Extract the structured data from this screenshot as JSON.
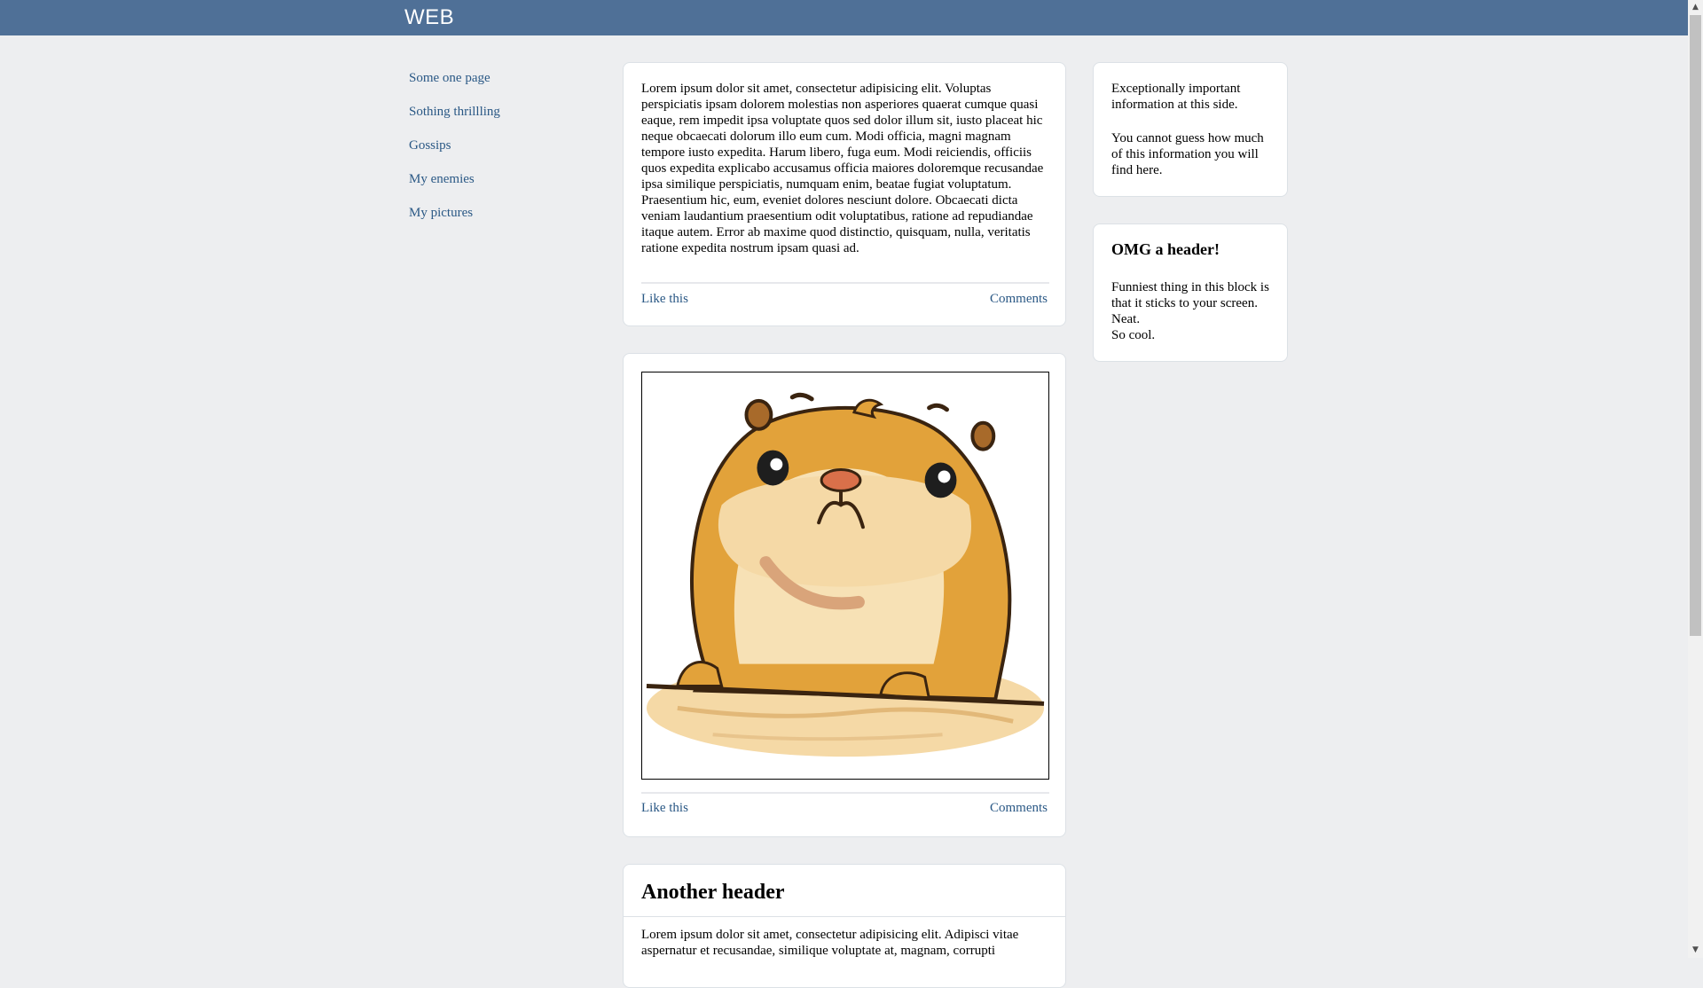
{
  "app": {
    "logo": "WEB"
  },
  "sidebar": {
    "items": [
      {
        "label": "Some one page"
      },
      {
        "label": "Sothing thrillling"
      },
      {
        "label": "Gossips"
      },
      {
        "label": "My enemies"
      },
      {
        "label": "My pictures"
      }
    ]
  },
  "feed": {
    "post1": {
      "text": "Lorem ipsum dolor sit amet, consectetur adipisicing elit. Voluptas perspiciatis ipsam dolorem molestias non asperiores quaerat cumque quasi eaque, rem impedit ipsa voluptate quos sed dolor illum sit, iusto placeat hic neque obcaecati dolorum illo eum cum. Modi officia, magni magnam tempore iusto expedita. Harum libero, fuga eum. Modi reiciendis, officiis quos expedita explicabo accusamus officia maiores doloremque recusandae ipsa similique perspiciatis, numquam enim, beatae fugiat voluptatum. Praesentium hic, eum, eveniet dolores nesciunt dolore. Obcaecati dicta veniam laudantium praesentium odit voluptatibus, ratione ad repudiandae itaque autem. Error ab maxime quod distinctio, quisquam, nulla, veritatis ratione expedita nostrum ipsam quasi ad.",
      "like_label": "Like this",
      "comments_label": "Comments"
    },
    "post2": {
      "image_icon": "hamster-illustration",
      "like_label": "Like this",
      "comments_label": "Comments"
    },
    "post3": {
      "header": "Another header",
      "text": "Lorem ipsum dolor sit amet, consectetur adipisicing elit. Adipisci vitae aspernatur et recusandae, similique voluptate at, magnam, corrupti"
    }
  },
  "aside": {
    "block1": {
      "line1": "Exceptionally important information at this side.",
      "line2": "You cannot guess how much of this information you will find here."
    },
    "block2": {
      "header": "OMG a header!",
      "text": "Funniest thing in this block is that it sticks to your screen. Neat.",
      "text2": "So cool."
    }
  },
  "colors": {
    "topbar": "#4f7097",
    "background": "#edeef0",
    "link": "#2a5885"
  }
}
